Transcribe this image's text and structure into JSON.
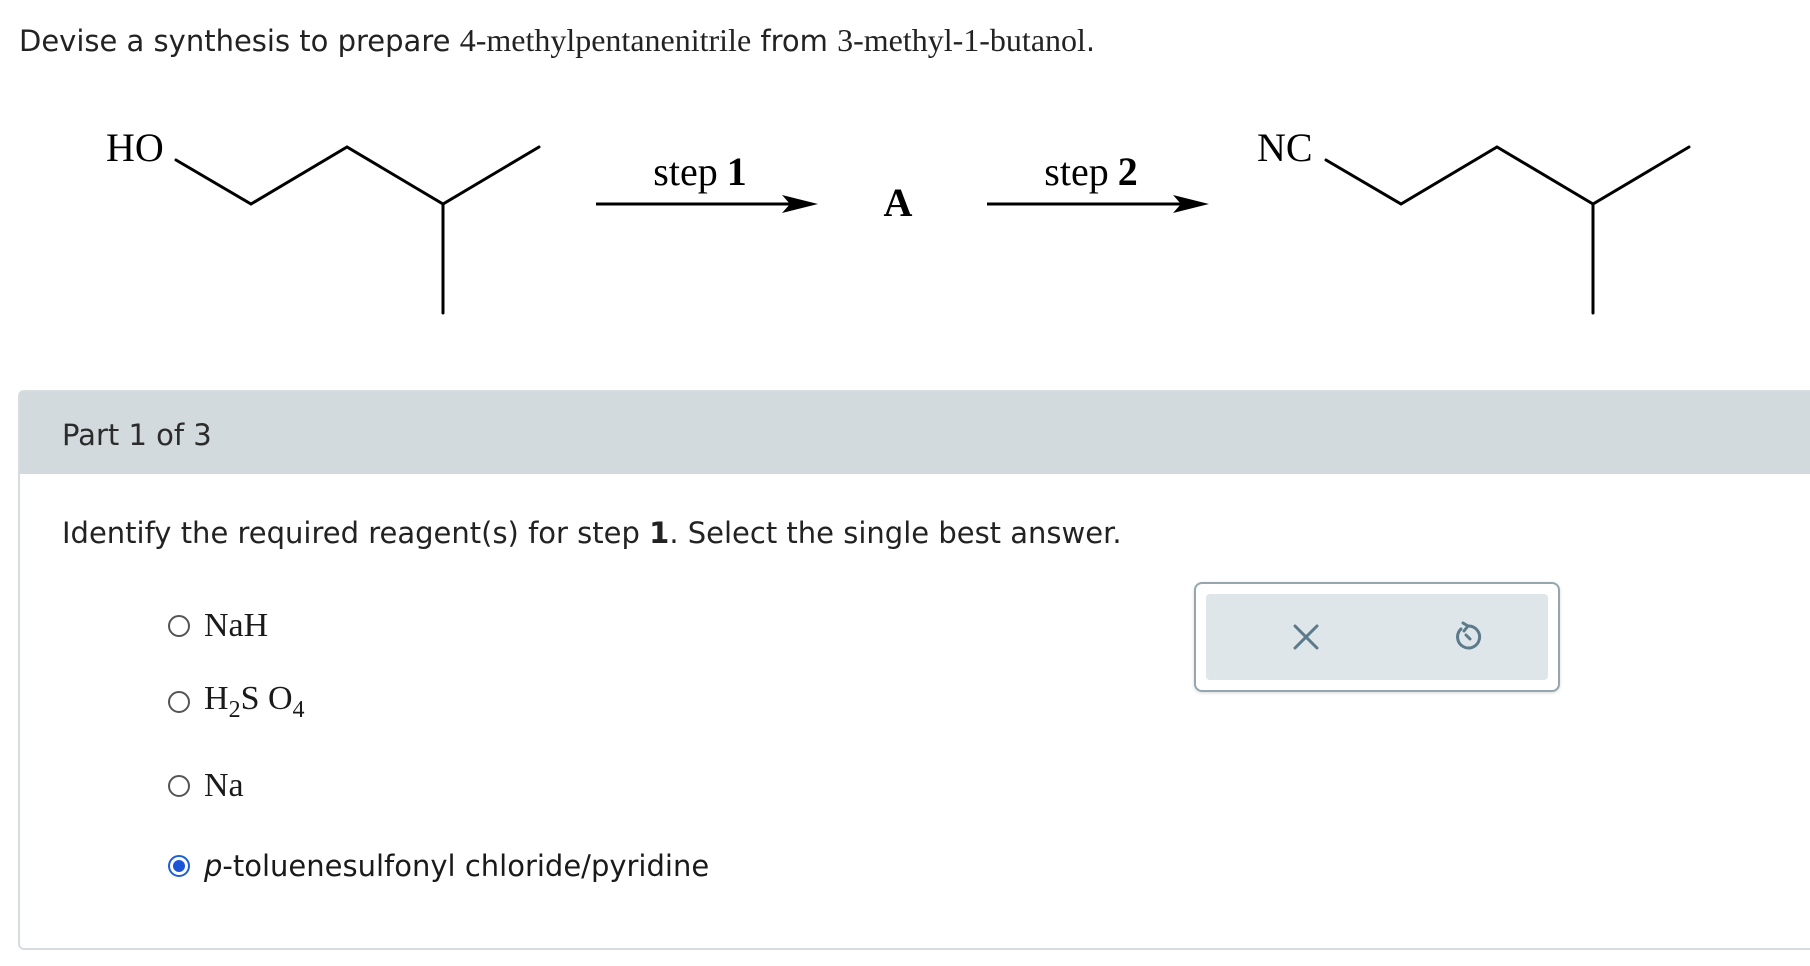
{
  "problem": {
    "prefix": "Devise a synthesis to prepare ",
    "target": "4-methylpentanenitrile",
    "middle": " from ",
    "start": "3-methyl-1-butanol",
    "suffix": "."
  },
  "scheme": {
    "start_label": "HO",
    "product_label": "NC",
    "step1_word": "step",
    "step1_num": "1",
    "intermediate": "A",
    "step2_word": "step",
    "step2_num": "2"
  },
  "part": {
    "label": "Part 1 of 3"
  },
  "question": {
    "prefix": "Identify the required reagent(s) for step ",
    "step": "1",
    "suffix": ". Select the single best answer."
  },
  "options": [
    {
      "id": "nah",
      "text": "NaH",
      "selected": false
    },
    {
      "id": "h2so4",
      "text_parts": [
        "H",
        "2",
        "S O",
        "4"
      ],
      "selected": false
    },
    {
      "id": "na",
      "text": "Na",
      "selected": false
    },
    {
      "id": "tscl",
      "italic_prefix": "p",
      "text": "-toluenesulfonyl chloride/pyridine",
      "selected": true
    }
  ],
  "tools": {
    "clear_icon": "close-icon",
    "reset_icon": "undo-icon"
  },
  "colors": {
    "header_bg": "#d3dadd",
    "selected_radio": "#1a56d6",
    "tool_bg": "#dfe6e9",
    "tool_icon": "#5b7a8a"
  }
}
